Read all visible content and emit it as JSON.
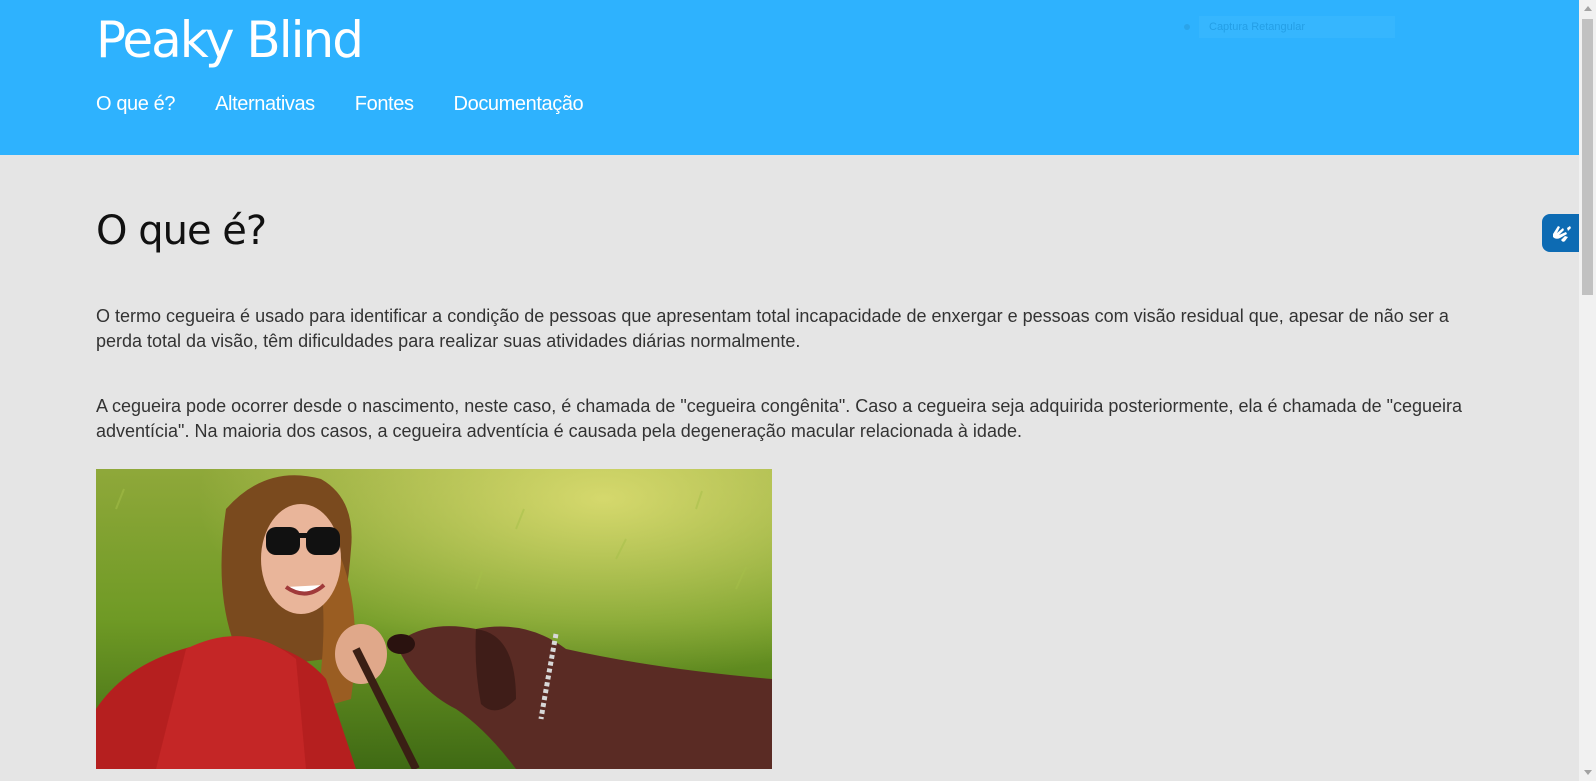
{
  "header": {
    "title": "Peaky Blind",
    "nav": [
      {
        "label": "O que é?"
      },
      {
        "label": "Alternativas"
      },
      {
        "label": "Fontes"
      },
      {
        "label": "Documentação"
      }
    ],
    "capture_placeholder": "Captura Retangular"
  },
  "main": {
    "heading": "O que é?",
    "paragraphs": [
      "O termo cegueira é usado para identificar a condição de pessoas que apresentam total incapacidade de enxergar e pessoas com visão residual que, apesar de não ser a perda total da visão, têm dificuldades para realizar suas atividades diárias normalmente.",
      "A cegueira pode ocorrer desde o nascimento, neste caso, é chamada de \"cegueira congênita\". Caso a cegueira seja adquirida posteriormente, ela é chamada de \"cegueira adventícia\". Na maioria dos casos, a cegueira adventícia é causada pela degeneração macular relacionada à idade."
    ]
  },
  "icons": {
    "accessibility": "sign-language-hands-icon"
  },
  "colors": {
    "header_bg": "#2eb2fe",
    "page_bg": "#e5e5e5",
    "accessibility_btn": "#0d6bb3"
  }
}
